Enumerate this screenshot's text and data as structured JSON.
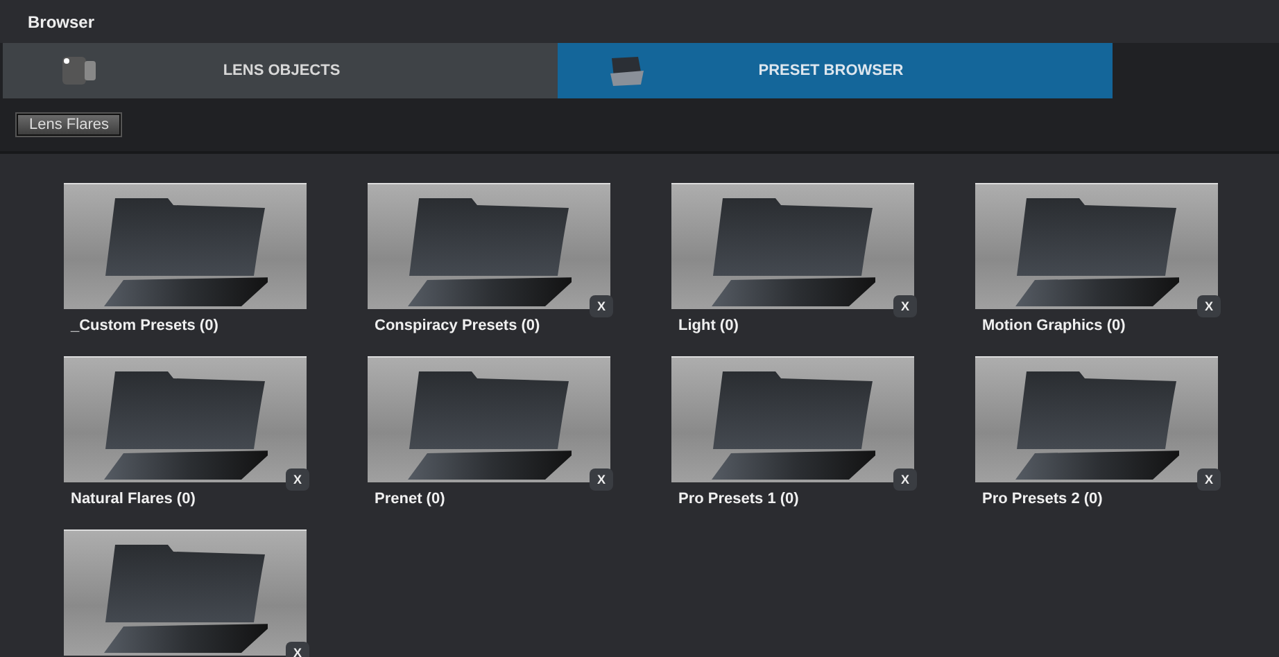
{
  "window": {
    "title": "Browser"
  },
  "tabs": [
    {
      "label": "LENS OBJECTS",
      "selected": false,
      "kind": "lens"
    },
    {
      "label": "PRESET BROWSER",
      "selected": true,
      "kind": "folder"
    }
  ],
  "breadcrumb": {
    "label": "Lens Flares"
  },
  "folders": [
    {
      "label": "_Custom Presets (0)"
    },
    {
      "label": "Conspiracy Presets (0)",
      "remove": "X"
    },
    {
      "label": "Light (0)",
      "remove": "X"
    },
    {
      "label": "Motion Graphics (0)",
      "remove": "X"
    },
    {
      "label": "Natural Flares (0)",
      "remove": "X"
    },
    {
      "label": "Prenet (0)",
      "remove": "X"
    },
    {
      "label": "Pro Presets 1 (0)",
      "remove": "X"
    },
    {
      "label": "Pro Presets 2 (0)",
      "remove": "X"
    },
    {
      "remove": "X"
    }
  ]
}
